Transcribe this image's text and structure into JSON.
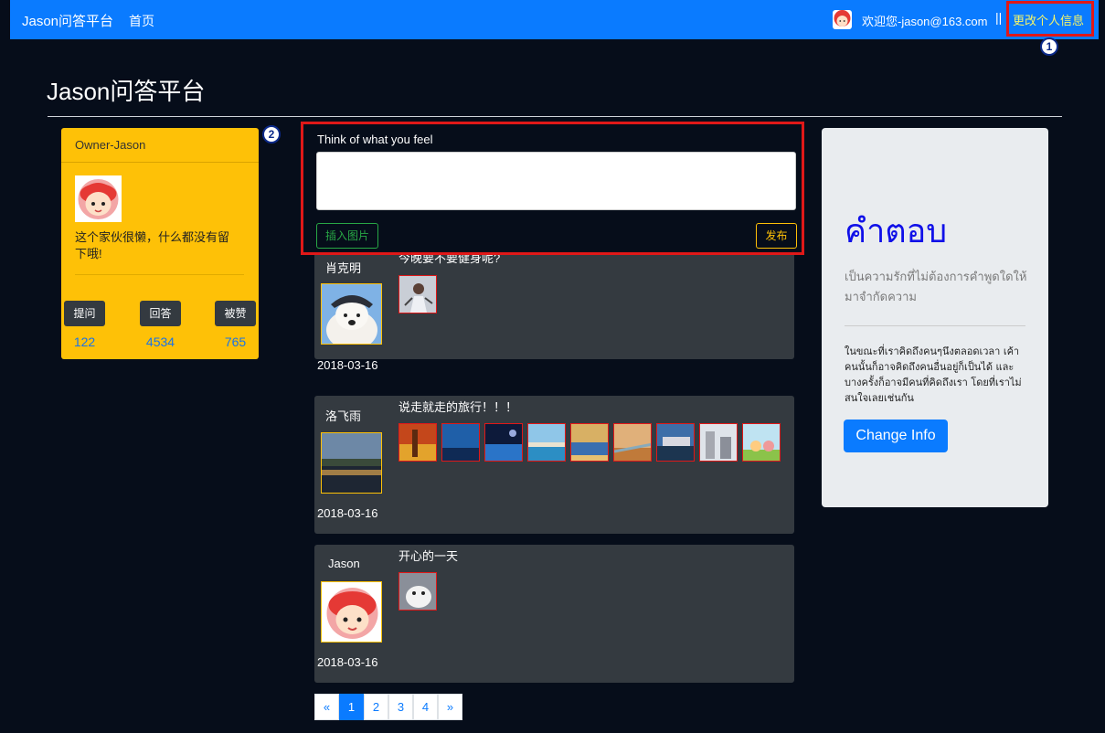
{
  "navbar": {
    "brand": "Jason问答平台",
    "home": "首页",
    "welcome": "欢迎您-jason@163.com",
    "separator": "||",
    "edit_profile": "更改个人信息"
  },
  "markers": [
    "1",
    "2"
  ],
  "page_title": "Jason问答平台",
  "owner_card": {
    "name": "Owner-Jason",
    "bio": "这个家伙很懒，什么都没有留下哦!",
    "stats": [
      {
        "label": "提问",
        "value": "122"
      },
      {
        "label": "回答",
        "value": "4534"
      },
      {
        "label": "被赞",
        "value": "765"
      }
    ]
  },
  "composer": {
    "label": "Think of what you feel",
    "insert_image": "插入图片",
    "publish": "发布"
  },
  "posts": [
    {
      "author": "肖克明",
      "title": "今晚要不要健身呢?",
      "date": "2018-03-16"
    },
    {
      "author": "洛飞雨",
      "title": "说走就走的旅行！！！",
      "date": "2018-03-16"
    },
    {
      "author": "Jason",
      "title": "开心的一天",
      "date": "2018-03-16"
    }
  ],
  "pagination": [
    "«",
    "1",
    "2",
    "3",
    "4",
    "»"
  ],
  "jumbotron": {
    "title": "คำตอบ",
    "lead": "เป็นความรักที่ไม่ต้องการคำพูดใดให้มาจำกัดความ",
    "text": "ในขณะที่เราคิดถึงคนๆนึงตลอดเวลา เค้าคนนั้นก็อาจคิดถึงคนอื่นอยู่ก็เป็นได้ และบางครั้งก็อาจมีคนที่คิดถึงเรา โดยที่เราไม่สนใจเลยเช่นกัน",
    "button": "Change Info"
  },
  "colors": {
    "navbar": "#0a7bff",
    "background": "#060d1a",
    "card": "#fec107",
    "post": "#343a40",
    "highlight_box": "#e01818",
    "jumbo_title": "#1010e8"
  }
}
